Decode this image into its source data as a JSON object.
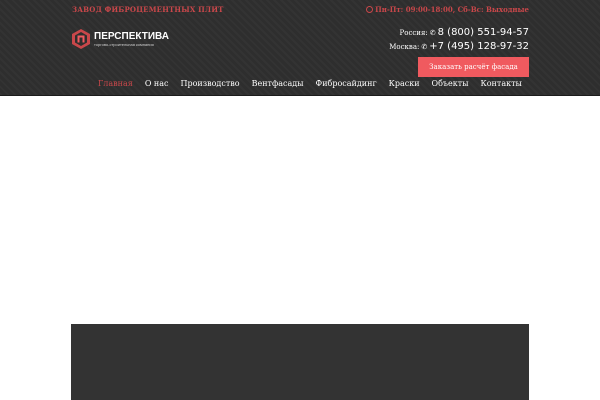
{
  "topbar": {
    "left_text": "ЗАВОД ФИБРОЦЕМЕНТНЫХ ПЛИТ",
    "hours_icon": "clock-icon",
    "hours_text": "Пн-Пт: 09:00-18:00, Сб-Вс: Выходные"
  },
  "logo": {
    "name": "ПЕРСПЕКТИВА",
    "tagline": "торгово-строительная компания"
  },
  "phones": [
    {
      "city": "Россия:",
      "icon": "phone-icon",
      "number": "8 (800) 551-94-57"
    },
    {
      "city": "Москва:",
      "icon": "phone-icon",
      "number": "+7 (495) 128-97-32"
    }
  ],
  "order_button": {
    "label": "Заказать расчёт фасада"
  },
  "nav": {
    "items": [
      {
        "label": "Главная",
        "active": true
      },
      {
        "label": "О нас",
        "active": false
      },
      {
        "label": "Производство",
        "active": false
      },
      {
        "label": "Вентфасады",
        "active": false
      },
      {
        "label": "Фибросайдинг",
        "active": false
      },
      {
        "label": "Краски",
        "active": false
      },
      {
        "label": "Объекты",
        "active": false
      },
      {
        "label": "Контакты",
        "active": false
      }
    ]
  },
  "colors": {
    "header_bg": "#2e2e2e",
    "accent": "#f05a5f",
    "accent_text": "#c9474a",
    "footer_bg": "#333333"
  }
}
